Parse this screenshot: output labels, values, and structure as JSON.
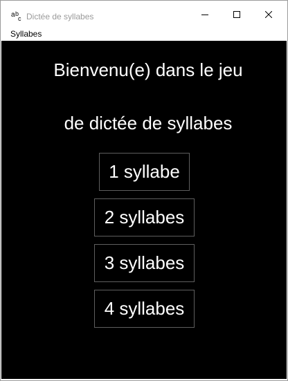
{
  "window": {
    "title": "Dictée de syllabes",
    "controls": [
      "minimize",
      "maximize",
      "close"
    ]
  },
  "menubar": {
    "items": [
      "Syllabes"
    ]
  },
  "main": {
    "heading_line1": "Bienvenu(e) dans le jeu",
    "heading_line2": "de dictée de syllabes",
    "buttons": [
      "1 syllabe",
      "2 syllabes",
      "3 syllabes",
      "4 syllabes"
    ]
  },
  "icons": {
    "app": "abc-icon",
    "minimize": "minimize-icon",
    "maximize": "maximize-icon",
    "close": "close-icon"
  },
  "colors": {
    "content_background": "#000000",
    "text": "#ffffff",
    "button_border": "#5f5f5f",
    "title_text": "#9a9a9a"
  }
}
